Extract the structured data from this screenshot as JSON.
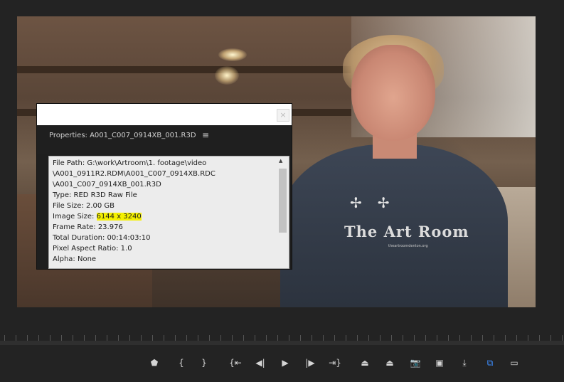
{
  "dialog": {
    "title": "Properties: A001_C007_0914XB_001.R3D",
    "menu_icon": "≡",
    "close_icon": "×",
    "lines": [
      "File Path: G:\\work\\Artroom\\1. footage\\video",
      "\\A001_0911R2.RDM\\A001_C007_0914XB.RDC",
      "\\A001_C007_0914XB_001.R3D",
      "Type: RED R3D Raw File",
      "File Size: 2.00 GB"
    ],
    "image_size_label": "Image Size: ",
    "image_size_value": "6144 x 3240",
    "lines_after": [
      "Frame Rate: 23.976",
      "Total Duration: 00:14:03:10",
      "Pixel Aspect Ratio: 1.0",
      "Alpha: None"
    ]
  },
  "video": {
    "shirt_text": "The Art Room",
    "shirt_subtext": "theartroomdenton.org"
  },
  "controls": [
    {
      "name": "add-marker-button",
      "glyph": "⬟"
    },
    {
      "name": "mark-in-button",
      "glyph": "{"
    },
    {
      "name": "mark-out-button",
      "glyph": "}"
    },
    {
      "name": "go-to-in-button",
      "glyph": "{⇤"
    },
    {
      "name": "step-back-button",
      "glyph": "◀|"
    },
    {
      "name": "play-button",
      "glyph": "▶"
    },
    {
      "name": "step-forward-button",
      "glyph": "|▶"
    },
    {
      "name": "go-to-out-button",
      "glyph": "⇥}"
    },
    {
      "name": "lift-button",
      "glyph": "⏏"
    },
    {
      "name": "extract-button",
      "glyph": "⏏"
    },
    {
      "name": "export-frame-button",
      "glyph": "📷"
    },
    {
      "name": "comparison-view-button",
      "glyph": "▣"
    },
    {
      "name": "insert-button",
      "glyph": "⤓"
    },
    {
      "name": "proxy-toggle-button",
      "glyph": "⧉"
    },
    {
      "name": "settings-button",
      "glyph": "▭"
    }
  ],
  "colors": {
    "highlight": "#f5f000",
    "active_button": "#3d8eff",
    "panel_background": "#232323"
  }
}
